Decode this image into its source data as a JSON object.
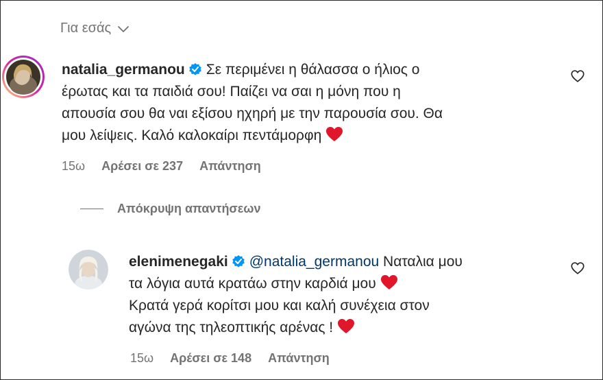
{
  "filter": {
    "label": "Για εσάς"
  },
  "comment1": {
    "username": "natalia_germanou",
    "lines": [
      "Σε περιμένει η θάλασσα ο ήλιος ο",
      "έρωτας και τα παιδιά σου! Παίζει να σαι η μόνη που η",
      "απουσία σου θα ναι εξίσου ηχηρή με την παρουσία σου. Θα",
      "μου λείψεις. Καλό καλοκαίρι πεντάμορφη"
    ],
    "emoji": "heart",
    "time": "15ω",
    "likes": "Αρέσει σε 237",
    "reply": "Απάντηση"
  },
  "replies_toggle": {
    "label": "Απόκρυψη απαντήσεων"
  },
  "comment2": {
    "username": "elenimenegaki",
    "mention": "@natalia_germanou",
    "lines": [
      "Ναταλια μου",
      "τα λόγια αυτά κρατάω στην καρδιά μου",
      "Κρατά γερά κορίτσι μου και καλή συνέχεια στον",
      "αγώνα της τηλεοπτικής αρένας !"
    ],
    "emoji": "heart",
    "time": "15ω",
    "likes": "Αρέσει σε 148",
    "reply": "Απάντηση"
  },
  "colors": {
    "text": "#262626",
    "secondary": "#737373",
    "mention": "#00376b",
    "verified": "#0095f6",
    "heart": "#e0162b",
    "story_ring": "#d6249f"
  }
}
